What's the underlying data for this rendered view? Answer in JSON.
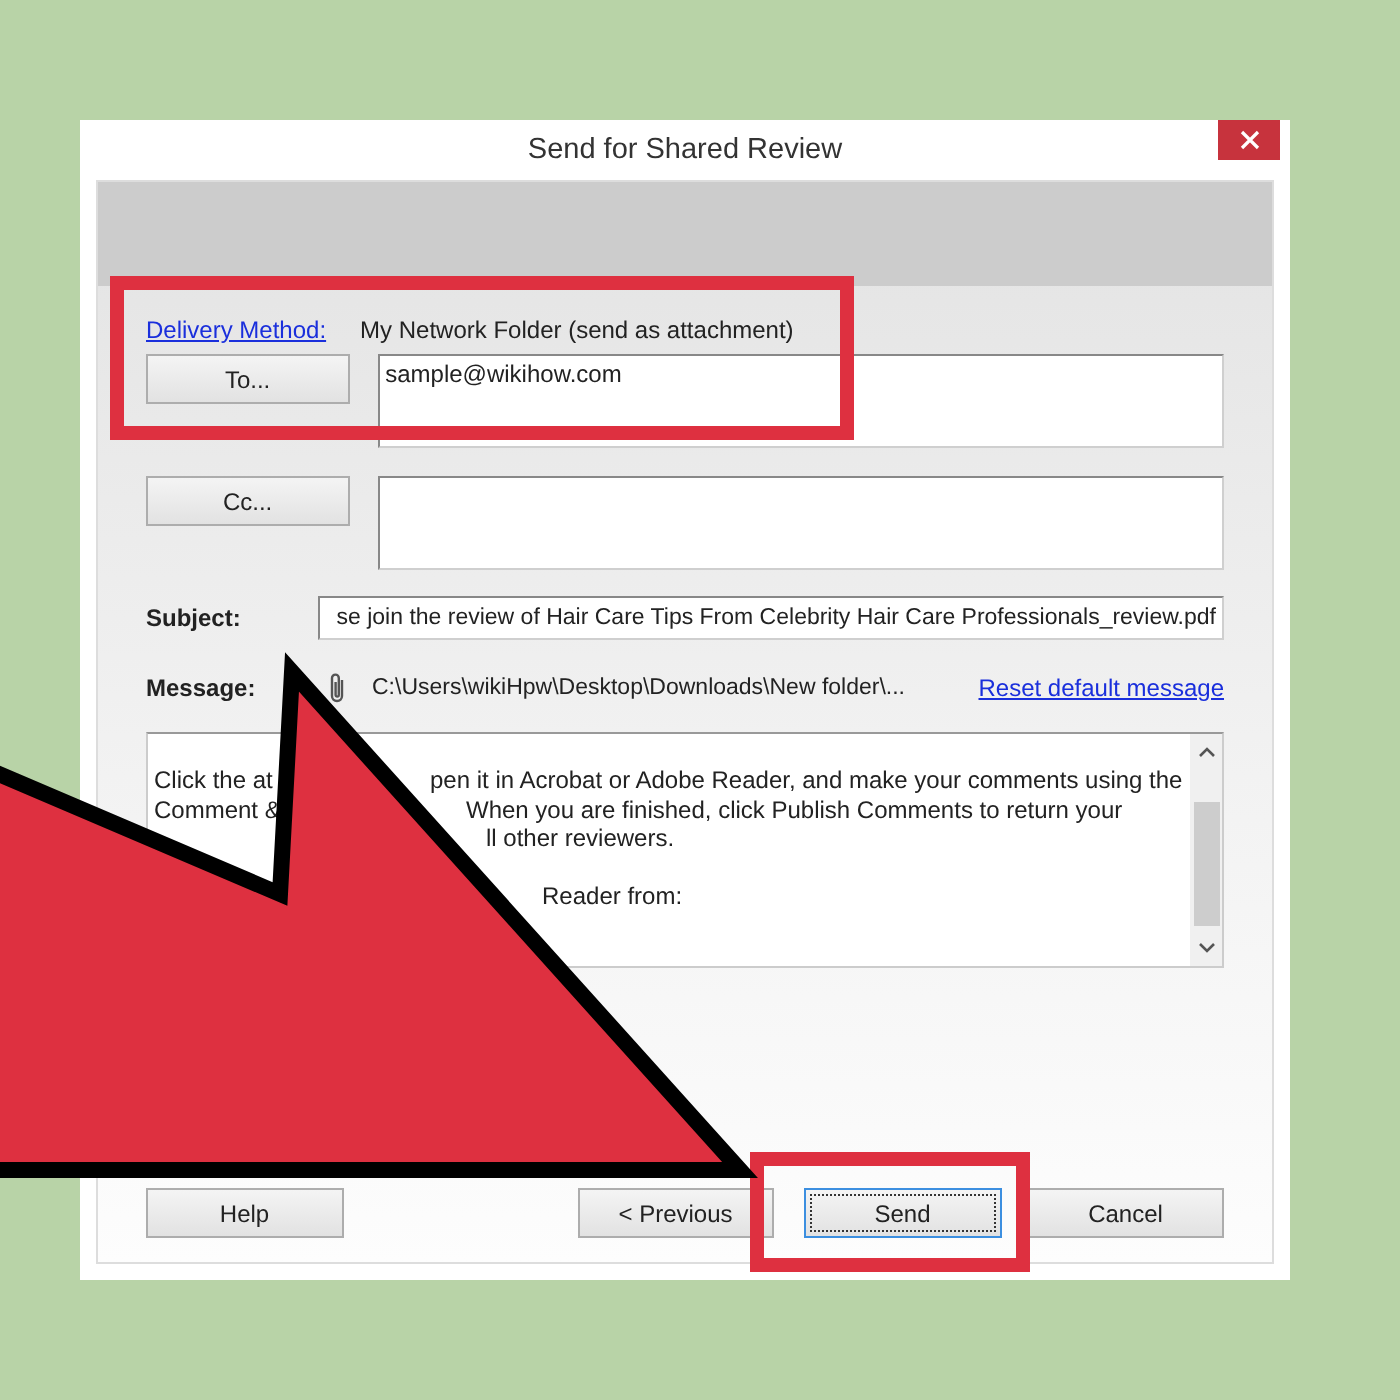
{
  "window": {
    "title": "Send for Shared Review"
  },
  "delivery": {
    "link": "Delivery Method:",
    "value": "My Network Folder (send as attachment)"
  },
  "to": {
    "button": "To...",
    "value": "sample@wikihow.com"
  },
  "cc": {
    "button": "Cc..."
  },
  "subject": {
    "label": "Subject:",
    "value": "se join the review of Hair Care Tips From Celebrity Hair Care Professionals_review.pdf"
  },
  "message": {
    "label": "Message:",
    "attachment": "C:\\Users\\wikiHpw\\Desktop\\Downloads\\New folder\\...",
    "reset_link": "Reset default message",
    "visible_text": [
      "Click the at",
      "pen it in Acrobat or Adobe Reader, and make your comments using the",
      "Comment &",
      "When you are finished, click Publish Comments to return your",
      "ll other reviewers.",
      "Reader from:"
    ]
  },
  "buttons": [
    {
      "label": "Help",
      "focused": false
    },
    {
      "label": "< Previous",
      "focused": false
    },
    {
      "label": "Send",
      "focused": true
    },
    {
      "label": "Cancel",
      "focused": false
    }
  ]
}
